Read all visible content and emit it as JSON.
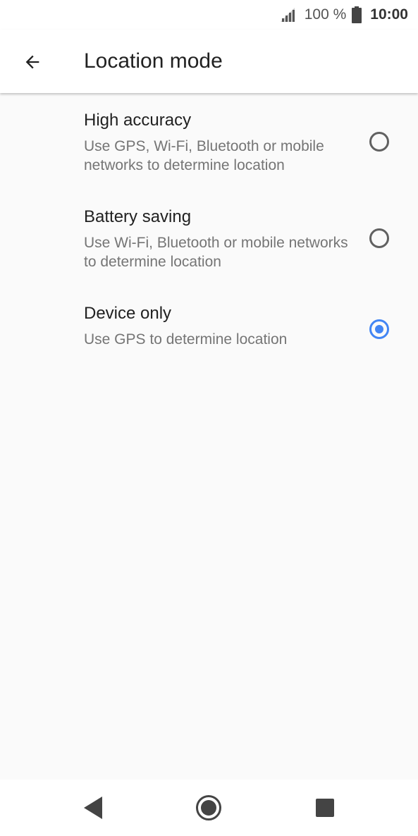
{
  "status_bar": {
    "battery_percent": "100 %",
    "time": "10:00",
    "icons": [
      "signal-icon",
      "battery-icon"
    ]
  },
  "header": {
    "title": "Location mode",
    "back_icon": "back-arrow-icon"
  },
  "options": [
    {
      "label": "High accuracy",
      "description": "Use GPS, Wi-Fi, Bluetooth or mobile networks to determine location",
      "selected": false
    },
    {
      "label": "Battery saving",
      "description": "Use Wi-Fi, Bluetooth or mobile networks to determine location",
      "selected": false
    },
    {
      "label": "Device only",
      "description": "Use GPS to determine location",
      "selected": true
    }
  ],
  "nav_bar": {
    "icons": [
      "nav-back-icon",
      "nav-home-icon",
      "nav-recents-icon"
    ]
  },
  "colors": {
    "accent": "#4285f4",
    "background": "#fafafa",
    "primary_text": "#212121",
    "secondary_text": "#757575"
  }
}
